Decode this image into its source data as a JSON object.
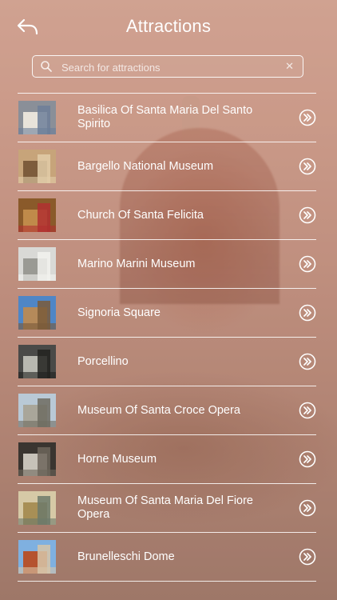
{
  "header": {
    "title": "Attractions",
    "back_icon": "back-arrow-icon"
  },
  "search": {
    "placeholder": "Search for attractions",
    "value": "",
    "clear_glyph": "✕"
  },
  "attractions": [
    {
      "name": "Basilica Of Santa Maria Del Santo Spirito",
      "thumb": [
        "#8a8f98",
        "#e8e3da",
        "#6d7f99"
      ]
    },
    {
      "name": "Bargello National Museum",
      "thumb": [
        "#c7a47a",
        "#7d5c3c",
        "#e2cda8"
      ]
    },
    {
      "name": "Church Of Santa Felicita",
      "thumb": [
        "#8a5a2a",
        "#c08a4a",
        "#b03030"
      ]
    },
    {
      "name": "Marino Marini Museum",
      "thumb": [
        "#d9d9d6",
        "#9a9a94",
        "#f2f2ee"
      ]
    },
    {
      "name": "Signoria Square",
      "thumb": [
        "#4f86c6",
        "#b58a5a",
        "#7a5a3a"
      ]
    },
    {
      "name": "Porcellino",
      "thumb": [
        "#4a4a48",
        "#b8b8b0",
        "#222220"
      ]
    },
    {
      "name": "Museum Of Santa Croce Opera",
      "thumb": [
        "#b9c9d6",
        "#a9a69a",
        "#6f6c61"
      ]
    },
    {
      "name": "Horne Museum",
      "thumb": [
        "#3a3530",
        "#c7c2b8",
        "#6d655a"
      ]
    },
    {
      "name": "Museum Of Santa Maria Del Fiore Opera",
      "thumb": [
        "#d6c9a6",
        "#a88f56",
        "#6d7a6a"
      ]
    },
    {
      "name": "Brunelleschi Dome",
      "thumb": [
        "#7fb0e0",
        "#b5532f",
        "#d7c5a8"
      ]
    }
  ],
  "arrow_icon": "double-chevron-right-icon"
}
